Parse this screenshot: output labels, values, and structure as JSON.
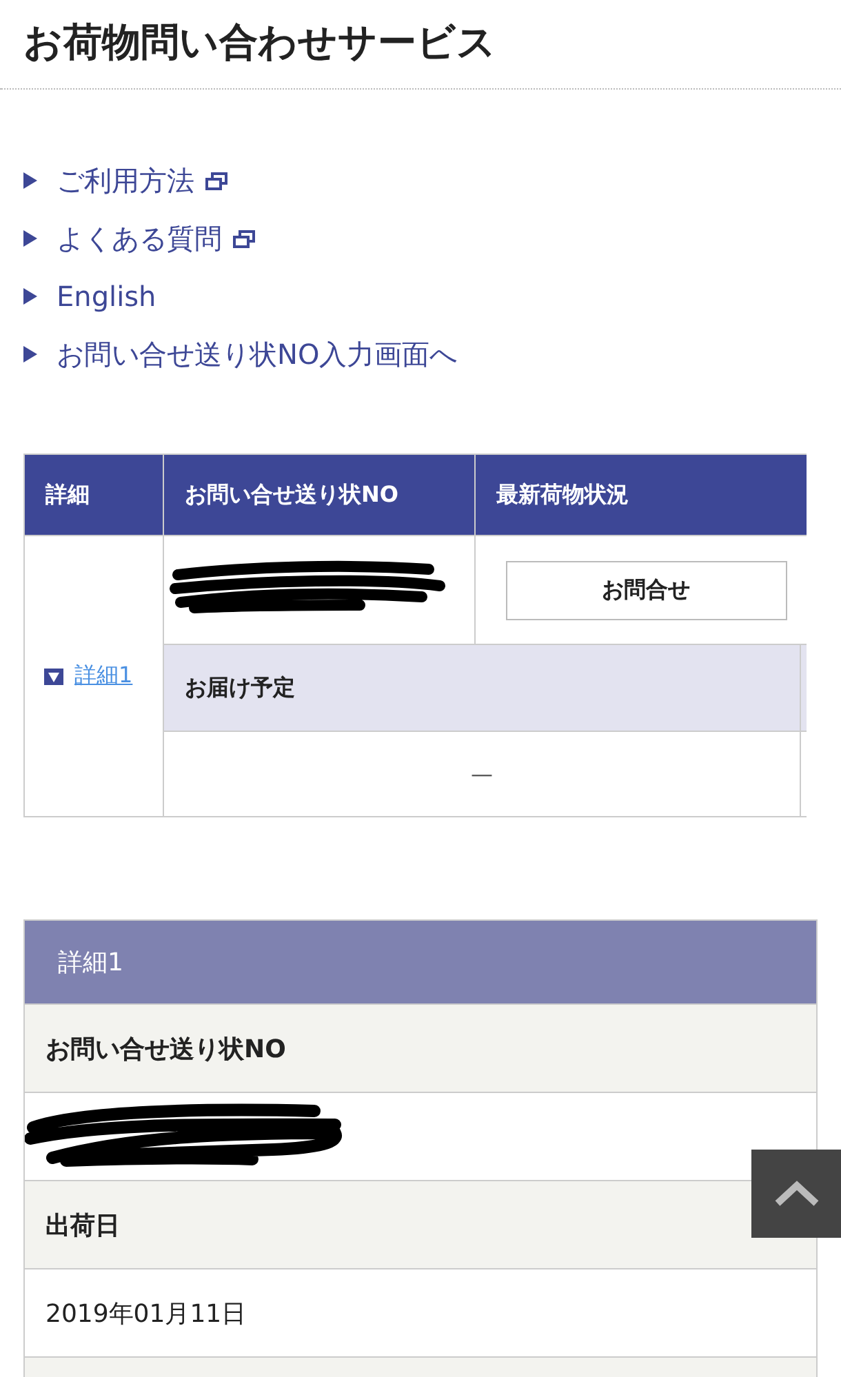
{
  "page_title": "お荷物問い合わせサービス",
  "links": [
    {
      "text": "ご利用方法",
      "external": true
    },
    {
      "text": "よくある質問",
      "external": true
    },
    {
      "text": "English",
      "external": false
    },
    {
      "text": "お問い合せ送り状NO入力画面へ",
      "external": false
    }
  ],
  "table": {
    "columns": [
      "詳細",
      "お問い合せ送り状NO",
      "最新荷物状況"
    ],
    "rows": [
      {
        "detail_link": "詳細1",
        "tracking_no": {
          "kind": "redacted"
        },
        "status_button": "お問合せ",
        "delivery_label": "お届け予定",
        "delivery_value": "—"
      }
    ]
  },
  "detail": {
    "title": "詳細1",
    "rows": [
      {
        "kind": "label",
        "text": "お問い合せ送り状NO"
      },
      {
        "kind": "redacted"
      },
      {
        "kind": "label",
        "text": "出荷日"
      },
      {
        "kind": "value",
        "text": "2019年01月11日"
      }
    ]
  }
}
